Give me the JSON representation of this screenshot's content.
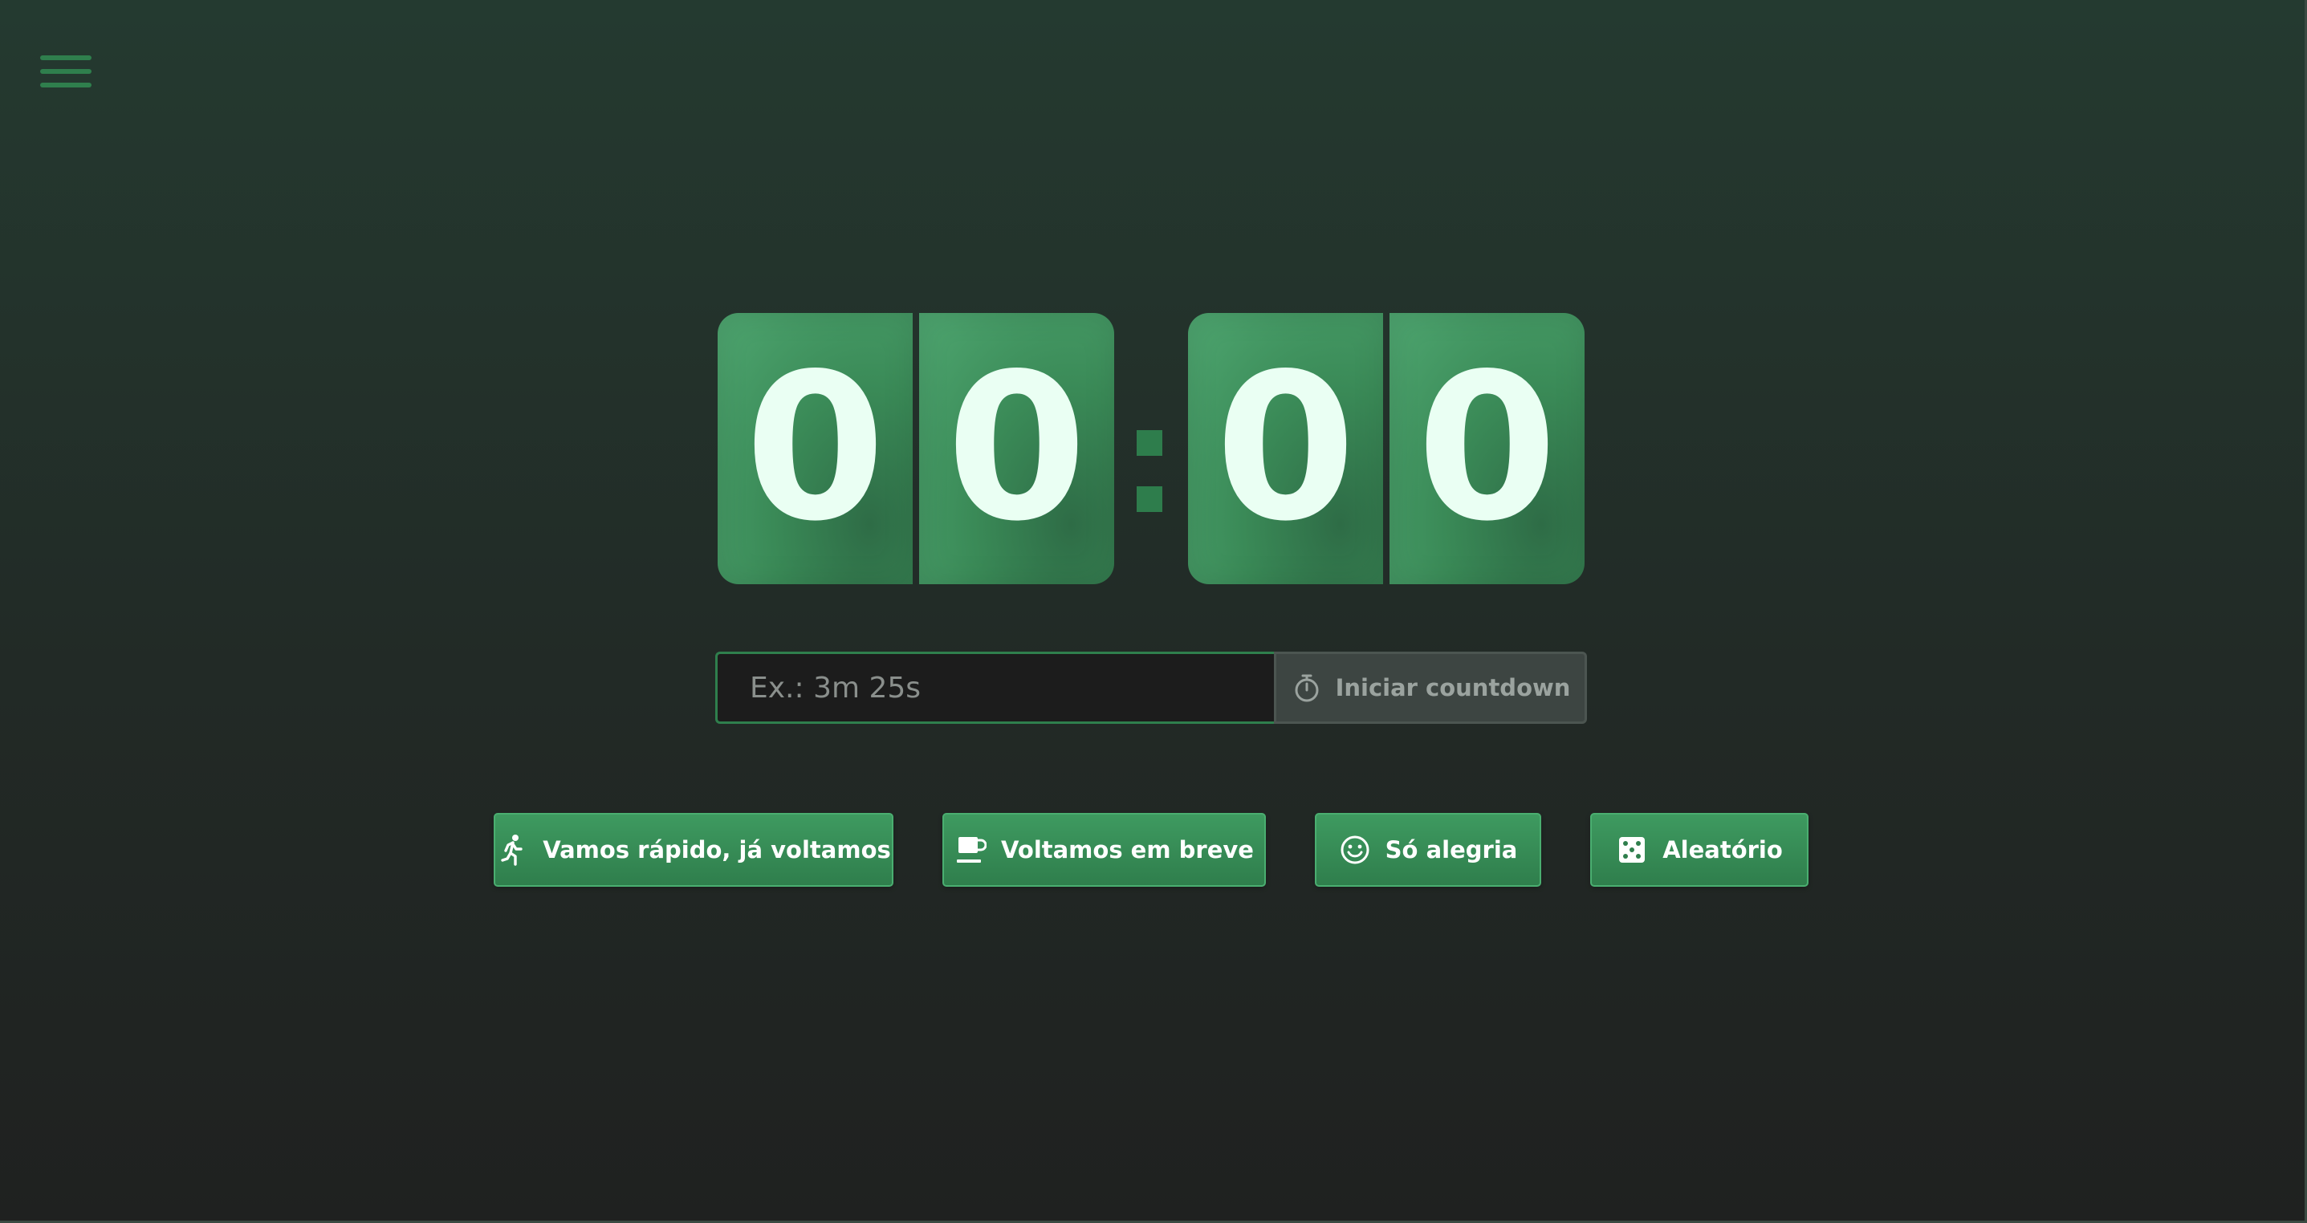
{
  "header": {
    "menu_icon": "hamburger-menu-icon",
    "theme_icon": "moon-icon"
  },
  "clock": {
    "minutes_tens": "0",
    "minutes_ones": "0",
    "separator": ":",
    "seconds_tens": "0",
    "seconds_ones": "0"
  },
  "countdown": {
    "value": "",
    "placeholder": "Ex.: 3m 25s",
    "start_label": "Iniciar countdown",
    "start_icon": "stopwatch-icon"
  },
  "presets": [
    {
      "label": "Vamos rápido, já voltamos",
      "icon": "running-person-icon"
    },
    {
      "label": "Voltamos em breve",
      "icon": "coffee-cup-icon"
    },
    {
      "label": "Só alegria",
      "icon": "smiley-icon"
    },
    {
      "label": "Aleatório",
      "icon": "dice-icon"
    }
  ],
  "colors": {
    "accent": "#3e9a60",
    "accent_dark": "#2f7f4d",
    "digit_text": "#eafff3",
    "background_top": "#243a30",
    "background_bottom": "#1f2120",
    "disabled_button": "#3d4542"
  }
}
